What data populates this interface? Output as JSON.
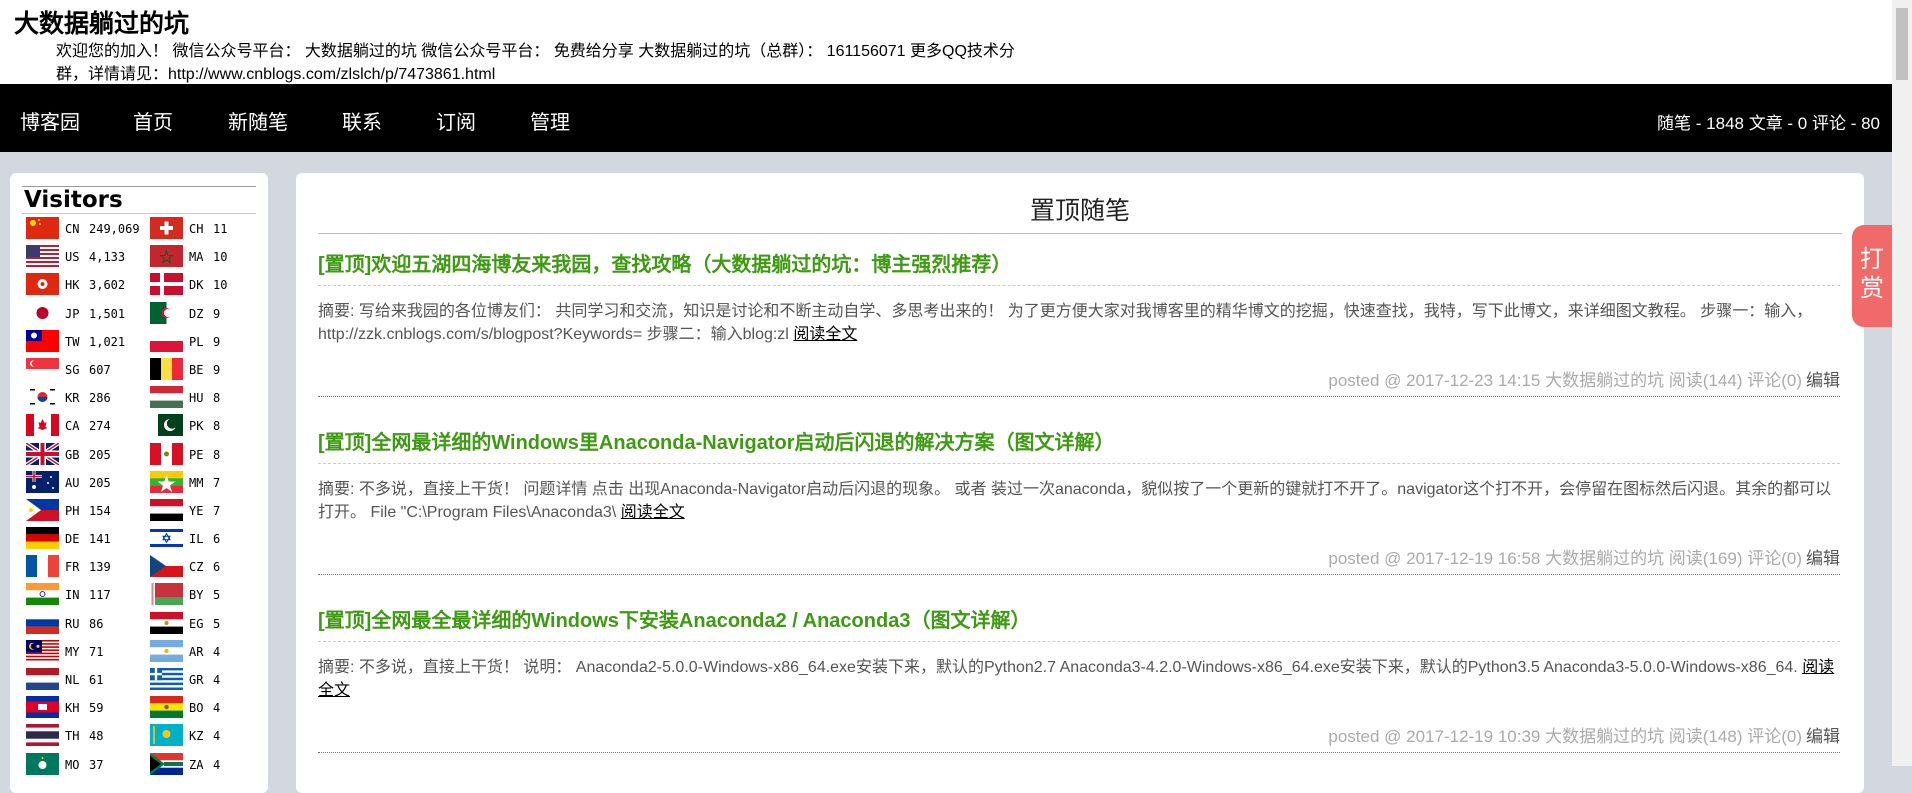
{
  "header": {
    "title": "大数据躺过的坑",
    "description": "欢迎您的加入！ 微信公众号平台： 大数据躺过的坑 微信公众号平台： 免费给分享 大数据躺过的坑（总群）： 161156071 更多QQ技术分群，详情请见：http://www.cnblogs.com/zlslch/p/7473861.html"
  },
  "nav": {
    "items": [
      "博客园",
      "首页",
      "新随笔",
      "联系",
      "订阅",
      "管理"
    ],
    "stats": "随笔 - 1848  文章 - 0  评论 - 80"
  },
  "sidebar": {
    "visitors_title": "Visitors",
    "flags_left": [
      {
        "code": "CN",
        "count": "249,069"
      },
      {
        "code": "US",
        "count": "4,133"
      },
      {
        "code": "HK",
        "count": "3,602"
      },
      {
        "code": "JP",
        "count": "1,501"
      },
      {
        "code": "TW",
        "count": "1,021"
      },
      {
        "code": "SG",
        "count": "607"
      },
      {
        "code": "KR",
        "count": "286"
      },
      {
        "code": "CA",
        "count": "274"
      },
      {
        "code": "GB",
        "count": "205"
      },
      {
        "code": "AU",
        "count": "205"
      },
      {
        "code": "PH",
        "count": "154"
      },
      {
        "code": "DE",
        "count": "141"
      },
      {
        "code": "FR",
        "count": "139"
      },
      {
        "code": "IN",
        "count": "117"
      },
      {
        "code": "RU",
        "count": "86"
      },
      {
        "code": "MY",
        "count": "71"
      },
      {
        "code": "NL",
        "count": "61"
      },
      {
        "code": "KH",
        "count": "59"
      },
      {
        "code": "TH",
        "count": "48"
      },
      {
        "code": "MO",
        "count": "37"
      }
    ],
    "flags_right": [
      {
        "code": "CH",
        "count": "11"
      },
      {
        "code": "MA",
        "count": "10"
      },
      {
        "code": "DK",
        "count": "10"
      },
      {
        "code": "DZ",
        "count": "9"
      },
      {
        "code": "PL",
        "count": "9"
      },
      {
        "code": "BE",
        "count": "9"
      },
      {
        "code": "HU",
        "count": "8"
      },
      {
        "code": "PK",
        "count": "8"
      },
      {
        "code": "PE",
        "count": "8"
      },
      {
        "code": "MM",
        "count": "7"
      },
      {
        "code": "YE",
        "count": "7"
      },
      {
        "code": "IL",
        "count": "6"
      },
      {
        "code": "CZ",
        "count": "6"
      },
      {
        "code": "BY",
        "count": "5"
      },
      {
        "code": "EG",
        "count": "5"
      },
      {
        "code": "AR",
        "count": "4"
      },
      {
        "code": "GR",
        "count": "4"
      },
      {
        "code": "BO",
        "count": "4"
      },
      {
        "code": "KZ",
        "count": "4"
      },
      {
        "code": "ZA",
        "count": "4"
      }
    ]
  },
  "main": {
    "title": "置顶随笔",
    "posts": [
      {
        "title": "[置顶]欢迎五湖四海博友来我园，查找攻略（大数据躺过的坑：博主强烈推荐）",
        "summary": "摘要: 写给来我园的各位博友们： 共同学习和交流，知识是讨论和不断主动自学、多思考出来的！ 为了更方便大家对我博客里的精华博文的挖掘，快速查找，我特，写下此博文，来详细图文教程。 步骤一：输入，http://zzk.cnblogs.com/s/blogpost?Keywords= 步骤二：输入blog:zl ",
        "read_more": "阅读全文",
        "meta": "posted @ 2017-12-23 14:15 大数据躺过的坑 阅读(144) 评论(0)",
        "edit": "编辑"
      },
      {
        "title": "[置顶]全网最详细的Windows里Anaconda-Navigator启动后闪退的解决方案（图文详解）",
        "summary": "摘要: 不多说，直接上干货！ 问题详情 点击 出现Anaconda-Navigator启动后闪退的现象。 或者 装过一次anaconda，貌似按了一个更新的键就打不开了。navigator这个打不开，会停留在图标然后闪退。其余的都可以打开。 File \"C:\\Program Files\\Anaconda3\\ ",
        "read_more": "阅读全文",
        "meta": "posted @ 2017-12-19 16:58 大数据躺过的坑 阅读(169) 评论(0)",
        "edit": "编辑"
      },
      {
        "title": "[置顶]全网最全最详细的Windows下安装Anaconda2 / Anaconda3（图文详解）",
        "summary": "摘要: 不多说，直接上干货！ 说明： Anaconda2-5.0.0-Windows-x86_64.exe安装下来，默认的Python2.7 Anaconda3-4.2.0-Windows-x86_64.exe安装下来，默认的Python3.5 Anaconda3-5.0.0-Windows-x86_64. ",
        "read_more": "阅读全文",
        "meta": "posted @ 2017-12-19 10:39 大数据躺过的坑 阅读(148) 评论(0)",
        "edit": "编辑"
      }
    ]
  },
  "reward": {
    "label": "打赏"
  },
  "colors": {
    "accent_green": "#3e9a12",
    "nav_bg": "#000000",
    "reward_bg": "#f06a6a",
    "page_bg": "#d3d8df"
  }
}
